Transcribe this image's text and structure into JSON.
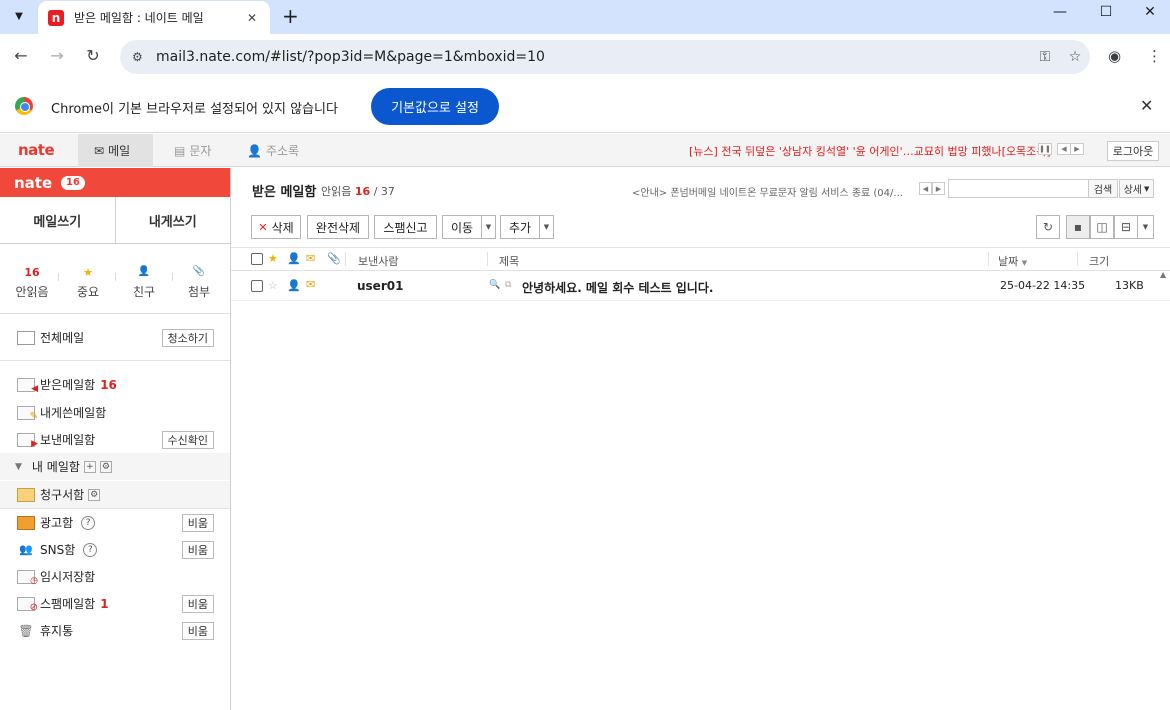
{
  "browser": {
    "tab_title": "받은 메일함 : 네이트 메일",
    "favicon_letter": "n",
    "url": "mail3.nate.com/#list/?pop3id=M&page=1&mboxid=10",
    "infobar_text": "Chrome이 기본 브라우저로 설정되어 있지 않습니다",
    "infobar_button": "기본값으로 설정"
  },
  "gnb": {
    "logo": "nate",
    "tabs": [
      {
        "label": "메일",
        "icon": "envelope-icon",
        "active": true
      },
      {
        "label": "문자",
        "icon": "phone-icon",
        "active": false
      },
      {
        "label": "주소록",
        "icon": "person-icon",
        "active": false
      }
    ],
    "news": "[뉴스] 전국 뒤덮은 '상남자 킹석열' '윤 어게인'…교묘히 법망 피했나[오목조목]",
    "logout": "로그아웃"
  },
  "sidebar": {
    "logo": "nate",
    "badge": "16",
    "compose": "메일쓰기",
    "compose_self": "내게쓰기",
    "quick": [
      {
        "top": "16",
        "label": "안읽음"
      },
      {
        "top": "★",
        "label": "중요"
      },
      {
        "top": "👤",
        "label": "친구"
      },
      {
        "top": "📎",
        "label": "첨부"
      }
    ],
    "all_mail": "전체메일",
    "clean_btn": "청소하기",
    "inbox": "받은메일함",
    "inbox_count": "16",
    "sent_self": "내게쓴메일함",
    "sent": "보낸메일함",
    "receipt_btn": "수신확인",
    "my_folders": "내 메일함",
    "bills": "청구서함",
    "ads": "광고함",
    "sns": "SNS함",
    "drafts": "임시저장함",
    "spam": "스팸메일함",
    "spam_count": "1",
    "trash": "휴지통",
    "empty_btn": "비움"
  },
  "main": {
    "title": "받은 메일함",
    "unread_label": "안읽음",
    "unread_count": "16",
    "total": "/ 37",
    "notice": "<안내> 폰넘버메일 네이트온 무료문자 알림 서비스 종료 (04/...",
    "search_btn": "검색",
    "detail_btn": "상세",
    "actions": {
      "delete": "삭제",
      "perm_delete": "완전삭제",
      "spam": "스팸신고",
      "move": "이동",
      "more": "추가"
    },
    "columns": {
      "sender": "보낸사람",
      "subject": "제목",
      "date": "날짜",
      "size": "크기"
    },
    "rows": [
      {
        "sender": "user01",
        "subject": "안녕하세요. 메일 회수 테스트 입니다.",
        "date": "25-04-22 14:35",
        "size": "13KB"
      }
    ]
  }
}
